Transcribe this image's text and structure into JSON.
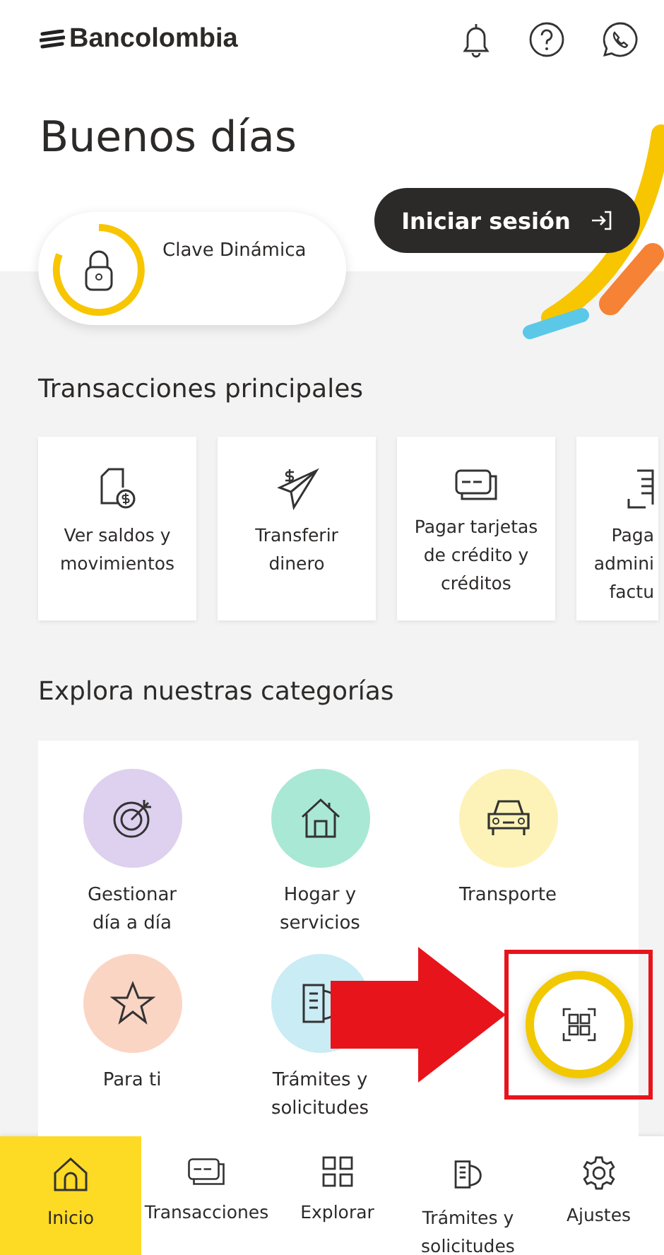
{
  "header": {
    "brand": "Bancolombia"
  },
  "greeting": "Buenos días",
  "login_button": "Iniciar sesión",
  "dynamic_key": {
    "label": "Clave Dinámica"
  },
  "transactions": {
    "title": "Transacciones principales",
    "items": [
      {
        "label": "Ver saldos y\nmovimientos"
      },
      {
        "label": "Transferir\ndinero"
      },
      {
        "label": "Pagar tarjetas\nde crédito y\ncréditos"
      },
      {
        "label": "Paga\nadmini\nfactu"
      }
    ]
  },
  "categories": {
    "title": "Explora nuestras categorías",
    "items": [
      {
        "label": "Gestionar\ndía a día",
        "color": "#ddd1ef"
      },
      {
        "label": "Hogar y\nservicios",
        "color": "#a9e8d5"
      },
      {
        "label": "Transporte",
        "color": "#fdf3b8"
      },
      {
        "label": "Para ti",
        "color": "#fbd5c4"
      },
      {
        "label": "Trámites y\nsolicitudes",
        "color": "#c9ecf5"
      }
    ]
  },
  "bottom_nav": [
    {
      "label": "Inicio",
      "selected": true
    },
    {
      "label": "Transacciones",
      "selected": false
    },
    {
      "label": "Explorar",
      "selected": false
    },
    {
      "label": "Trámites y\nsolicitudes",
      "selected": false
    },
    {
      "label": "Ajustes",
      "selected": false
    }
  ]
}
